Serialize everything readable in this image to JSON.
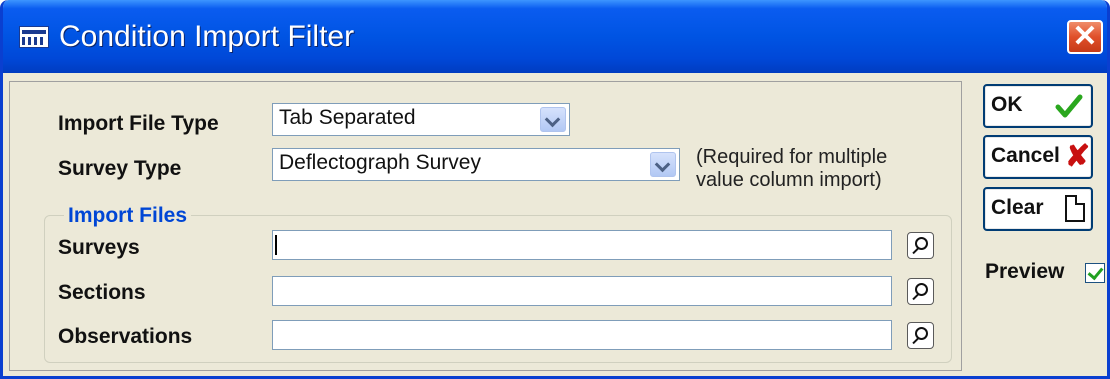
{
  "window": {
    "title": "Condition Import Filter",
    "accent_color": "#0054e3",
    "close_icon": "close-icon"
  },
  "form": {
    "import_file_type": {
      "label": "Import File Type",
      "value": "Tab Separated"
    },
    "survey_type": {
      "label": "Survey Type",
      "value": "Deflectograph Survey",
      "hint": "(Required for multiple value column import)"
    }
  },
  "import_files": {
    "title": "Import Files",
    "surveys": {
      "label": "Surveys",
      "value": ""
    },
    "sections": {
      "label": "Sections",
      "value": ""
    },
    "observations": {
      "label": "Observations",
      "value": ""
    }
  },
  "buttons": {
    "ok": "OK",
    "cancel": "Cancel",
    "clear": "Clear"
  },
  "preview": {
    "label": "Preview",
    "checked": true
  }
}
